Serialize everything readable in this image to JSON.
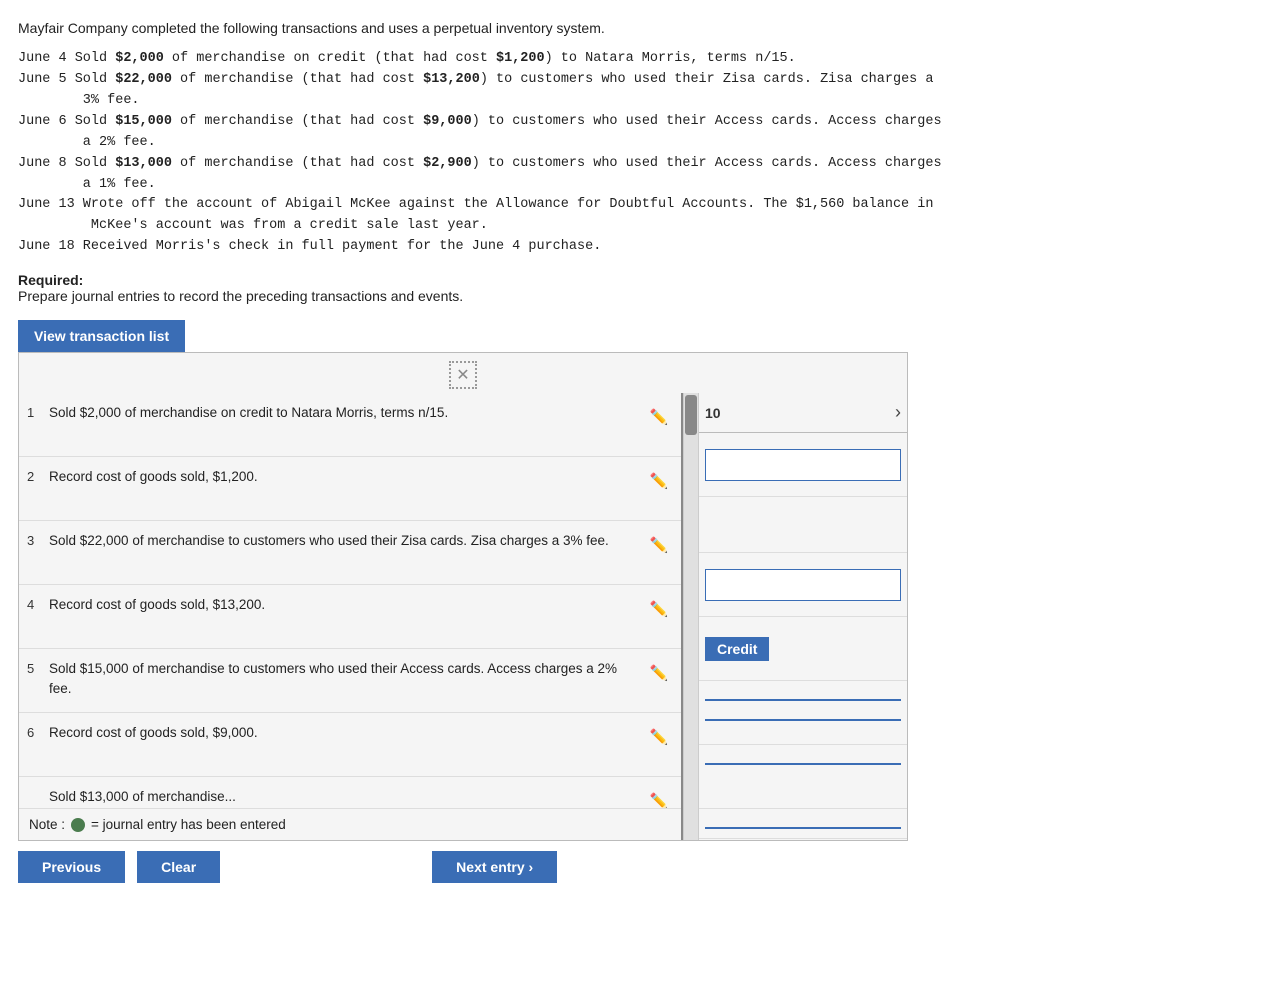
{
  "intro": {
    "text": "Mayfair Company completed the following transactions and uses a perpetual inventory system."
  },
  "transactions": [
    {
      "date": "June 4",
      "text": "Sold $2,000 of merchandise on credit (that had cost $1,200) to Natara Morris, terms n/15."
    },
    {
      "date": "June 5",
      "text": "Sold $22,000 of merchandise (that had cost $13,200) to customers who used their Zisa cards. Zisa charges a 3% fee."
    },
    {
      "date": "June 6",
      "text": "Sold $15,000 of merchandise (that had cost $9,000) to customers who used their Access cards. Access charges a 2% fee."
    },
    {
      "date": "June 8",
      "text": "Sold $13,000 of merchandise (that had cost $2,900) to customers who used their Access cards. Access charges a 1% fee."
    },
    {
      "date": "June 13",
      "text": "Wrote off the account of Abigail McKee against the Allowance for Doubtful Accounts. The $1,560 balance in McKee's account was from a credit sale last year."
    },
    {
      "date": "June 18",
      "text": "Received Morris's check in full payment for the June 4 purchase."
    }
  ],
  "required": {
    "label": "Required:",
    "desc": "Prepare journal entries to record the preceding transactions and events."
  },
  "view_btn": "View transaction list",
  "journal_rows": [
    {
      "num": "1",
      "desc": "Sold $2,000 of merchandise on credit to Natara Morris, terms n/15."
    },
    {
      "num": "2",
      "desc": "Record cost of goods sold, $1,200."
    },
    {
      "num": "3",
      "desc": "Sold $22,000 of merchandise to customers who used their Zisa cards. Zisa charges a 3% fee."
    },
    {
      "num": "4",
      "desc": "Record cost of goods sold, $13,200."
    },
    {
      "num": "5",
      "desc": "Sold $15,000 of merchandise to customers who used their Access cards. Access charges a 2% fee."
    },
    {
      "num": "6",
      "desc": "Record cost of goods sold, $9,000."
    }
  ],
  "right_panel": {
    "page_number": "10",
    "chevron": "›",
    "credit_label": "Credit"
  },
  "note": {
    "label": "Note :",
    "desc": "= journal entry has been entered"
  },
  "bottom_buttons": {
    "previous": "Previous",
    "clear": "Clear",
    "next": "Next entry ›"
  },
  "x_icon": "✕"
}
